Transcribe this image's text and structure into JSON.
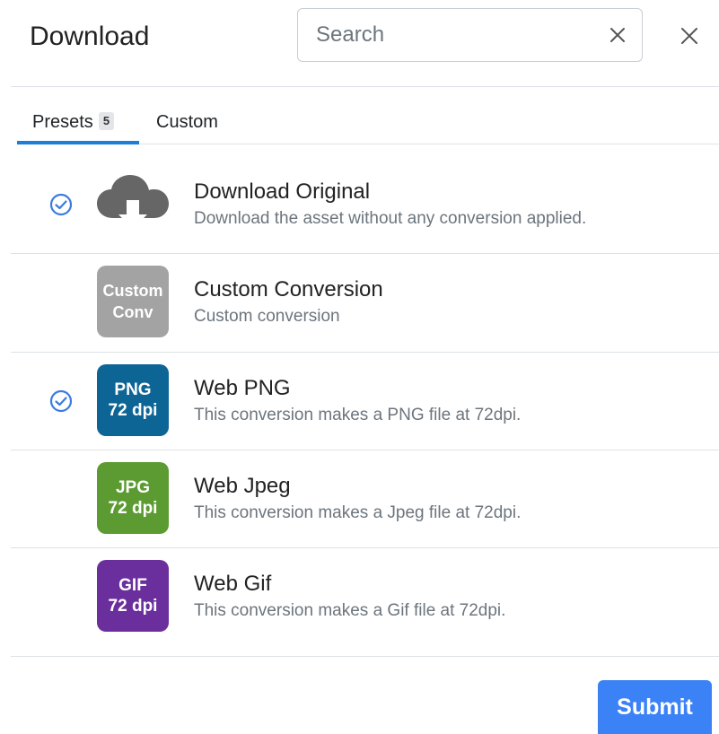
{
  "dialog": {
    "title": "Download",
    "close_icon": "close-icon"
  },
  "search": {
    "placeholder": "Search",
    "value": "",
    "clear_icon": "clear-icon"
  },
  "tabs": [
    {
      "label": "Presets",
      "count": "5",
      "active": true
    },
    {
      "label": "Custom",
      "active": false
    }
  ],
  "presets": [
    {
      "title": "Download Original",
      "description": "Download the asset without any conversion applied.",
      "checked": true,
      "icon": "cloud-download-icon",
      "tile_lines": [],
      "tile_color": "#666666"
    },
    {
      "title": "Custom Conversion",
      "description": "Custom conversion",
      "checked": false,
      "icon": "custom-conversion-tile",
      "tile_lines": [
        "Custom",
        "Conv"
      ],
      "tile_color": "#a3a3a3"
    },
    {
      "title": "Web PNG",
      "description": "This conversion makes a PNG file at 72dpi.",
      "checked": true,
      "icon": "png-tile",
      "tile_lines": [
        "PNG",
        "72 dpi"
      ],
      "tile_color": "#0d6596"
    },
    {
      "title": "Web Jpeg",
      "description": "This conversion makes a Jpeg file at 72dpi.",
      "checked": false,
      "icon": "jpg-tile",
      "tile_lines": [
        "JPG",
        "72 dpi"
      ],
      "tile_color": "#5b9b32"
    },
    {
      "title": "Web Gif",
      "description": "This conversion makes a Gif file at 72dpi.",
      "checked": false,
      "icon": "gif-tile",
      "tile_lines": [
        "GIF",
        "72 dpi"
      ],
      "tile_color": "#6a2f9c"
    }
  ],
  "footer": {
    "submit_label": "Submit"
  },
  "colors": {
    "accent": "#1c7ed6",
    "check": "#3b7be0",
    "submit": "#3b82f6"
  }
}
